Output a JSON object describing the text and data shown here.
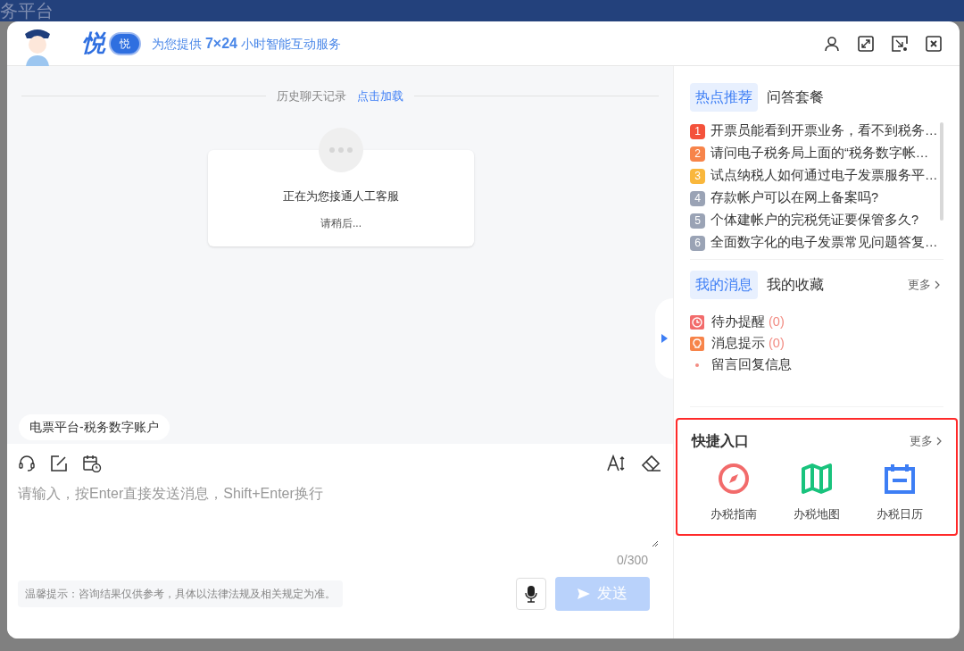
{
  "background_page": {
    "title": "务平台"
  },
  "header": {
    "brand": "悦",
    "badge": "悦",
    "tagline": "为您提供 **7×24** 小时智能互动服务"
  },
  "chat": {
    "history_label": "历史聊天记录",
    "load_link": "点击加载",
    "status_card": {
      "title": "正在为您接通人工客服",
      "subtitle": "请稍后..."
    },
    "context_chip": "电票平台-税务数字账户"
  },
  "composer": {
    "placeholder": "请输入，按Enter直接发送消息，Shift+Enter换行",
    "counter": "0/300",
    "tip": "温馨提示：咨询结果仅供参考，具体以法律法规及相关规定为准。",
    "send": {
      "label": "发送",
      "disabled": true
    }
  },
  "hot": {
    "tabs": [
      {
        "label": "热点推荐",
        "selected": true
      },
      {
        "label": "问答套餐",
        "selected": false
      }
    ],
    "items": [
      {
        "rank": "1",
        "text": "开票员能看到开票业务，看不到税务…",
        "color": "#f4523b"
      },
      {
        "rank": "2",
        "text": "请问电子税务局上面的“税务数字帐…",
        "color": "#f7844a"
      },
      {
        "rank": "3",
        "text": "试点纳税人如何通过电子发票服务平…",
        "color": "#f9b73c"
      },
      {
        "rank": "4",
        "text": "存款帐户可以在网上备案吗?",
        "color": "#9aa3b5"
      },
      {
        "rank": "5",
        "text": "个体建帐户的完税凭证要保管多久?",
        "color": "#9aa3b5"
      },
      {
        "rank": "6",
        "text": "全面数字化的电子发票常见问题答复…",
        "color": "#9aa3b5"
      }
    ]
  },
  "messages": {
    "tabs": [
      {
        "label": "我的消息",
        "selected": true
      },
      {
        "label": "我的收藏",
        "selected": false
      }
    ],
    "more": "更多",
    "items": [
      {
        "kind": "todo",
        "label": "待办提醒",
        "count": "(0)"
      },
      {
        "kind": "notice",
        "label": "消息提示",
        "count": "(0)"
      },
      {
        "kind": "bullet",
        "label": "留言回复信息"
      }
    ]
  },
  "quick": {
    "title": "快捷入口",
    "more": "更多",
    "highlighted": true,
    "items": [
      {
        "kind": "compass",
        "label": "办税指南"
      },
      {
        "kind": "map",
        "label": "办税地图"
      },
      {
        "kind": "calendar",
        "label": "办税日历"
      }
    ]
  }
}
